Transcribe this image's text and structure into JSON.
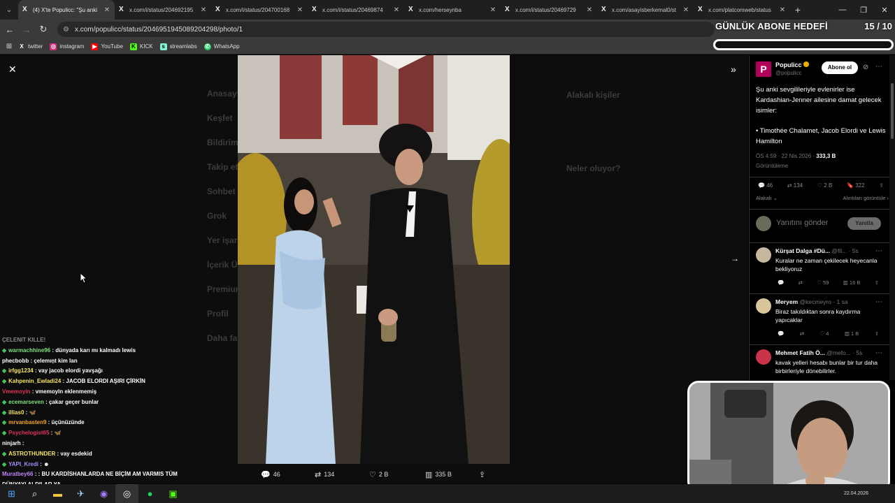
{
  "browser": {
    "tabs": [
      {
        "title": "(4) X'te Populicc: \"Şu anki",
        "active": true
      },
      {
        "title": "x.com/i/status/204692195",
        "active": false
      },
      {
        "title": "x.com/i/status/204700168",
        "active": false
      },
      {
        "title": "x.com/i/status/20469874",
        "active": false
      },
      {
        "title": "x.com/herseynba",
        "active": false
      },
      {
        "title": "x.com/i/status/20469729",
        "active": false
      },
      {
        "title": "x.com/asayisberkemal0/st",
        "active": false
      },
      {
        "title": "x.com/platcomweb/status",
        "active": false
      }
    ],
    "url": "x.com/populicc/status/2046951945089204298/photo/1",
    "bookmarks": [
      "twitter",
      "instagram",
      "YouTube",
      "KICK",
      "streamlabs",
      "WhatsApp"
    ]
  },
  "overlay": {
    "goal_title": "GÜNLÜK ABONE HEDEFİ",
    "goal_count": "15 / 10"
  },
  "viewer": {
    "ghost_menu": [
      "Anasayfa",
      "Keşfet",
      "Bildirimler",
      "Takip et",
      "Sohbet",
      "Grok",
      "Yer işaretleri",
      "İçerik Üret",
      "Premium",
      "Profil",
      "Daha fazla"
    ],
    "ghost_right_title": "Alakalı kişiler",
    "ghost_right_title2": "Neler oluyor?",
    "photo_stats": {
      "replies": "46",
      "reposts": "134",
      "likes": "2 B",
      "views": "335 B"
    }
  },
  "chat": [
    {
      "user": "",
      "text": "ÇELENIT KILLE!"
    },
    {
      "user": "warmachhine96",
      "color": "#7fe37f",
      "text": "dünyada karı mı kalmadı lewis",
      "dia": true
    },
    {
      "user": "phecbobb",
      "color": "#ffffff",
      "text": "çelemıņt kim lan",
      "dia": false
    },
    {
      "user": "irfgg1234",
      "color": "#f5e663",
      "text": "vay jacob elordi yavşağı",
      "dia": true
    },
    {
      "user": "Kahpenin_Ewladi24",
      "color": "#f5e663",
      "text": "JACOB ELORDI AŞIRI ÇİRKİN",
      "dia": true
    },
    {
      "user": "Vmemoyin",
      "color": "#e0335a",
      "text": "vmemoyln eklenmemiş",
      "dia": false
    },
    {
      "user": "ecemarseven",
      "color": "#7fe37f",
      "text": "çakar geçer bunlar",
      "dia": true
    },
    {
      "user": "illias0",
      "color": "#f5e663",
      "text": "🦋",
      "dia": true
    },
    {
      "user": "mrvanbasten9",
      "color": "#f5a623",
      "text": "üçünüzünde",
      "dia": true
    },
    {
      "user": "Psychelogist65",
      "color": "#e0335a",
      "text": "🦋",
      "dia": true
    },
    {
      "user": "ninjarh",
      "color": "#ffffff",
      "text": "",
      "dia": false
    },
    {
      "user": "ASTROTHUNDER",
      "color": "#f5e663",
      "text": "vay esdekid",
      "dia": true
    },
    {
      "user": "YAPI_Kredi",
      "color": "#a78bfa",
      "text": "☻",
      "dia": true
    },
    {
      "user": "Muratbey66",
      "color": "#c084fc",
      "text": ": BU KARDİSHANLARDA NE BİÇİM AM VARMIS TÜM",
      "dia": false
    },
    {
      "user": "",
      "color": "#ffffff",
      "text": "DÜNYAYI ALDILAR YA",
      "dia": false
    }
  ],
  "tweet": {
    "author": "Populicc",
    "handle": "@populicc",
    "follow_label": "Abone ol",
    "text_line1": "Şu anki sevgilileriyle evlenirler ise Kardashian-Jenner ailesine damat gelecek isimler:",
    "text_line2": "• Timothée Chalamet, Jacob Elordi ve Lewis Hamilton",
    "time": "ÖS 4:59 · 22 Nis 2026 · ",
    "views": "333,3 B",
    "views_label": "Görüntüleme",
    "replies": "46",
    "reposts": "134",
    "likes": "2 B",
    "bookmarks": "322",
    "sort_label": "Alakalı",
    "quotes_label": "Alıntıları görüntüle",
    "reply_placeholder": "Yanıtını gönder",
    "reply_button": "Yanıtla"
  },
  "replies": [
    {
      "name": "Kürşat Dalga #Dü...",
      "handle": "@fil... · 5s",
      "text": "Kuralar ne zaman çekilecek heyecanla bekliyoruz",
      "likes": "59",
      "views": "16 B",
      "avatar": "#c8b7a0"
    },
    {
      "name": "Meryem",
      "handle": "@kecmeyro · 1 sa",
      "text": "Biraz takıldıktan sonra kaydırma yapıcaklar",
      "likes": "4",
      "views": "1 B",
      "avatar": "#d9c59a"
    },
    {
      "name": "Mehmet Fatih Ö...",
      "handle": "@mefo... · 5s",
      "text": "kavak yelleri hesabı bunlar bir tur daha birbirleriyle dönebilirler.",
      "likes": "",
      "views": "",
      "avatar": "#c9344a"
    }
  ],
  "taskbar": {
    "date": "22.04.2026"
  }
}
